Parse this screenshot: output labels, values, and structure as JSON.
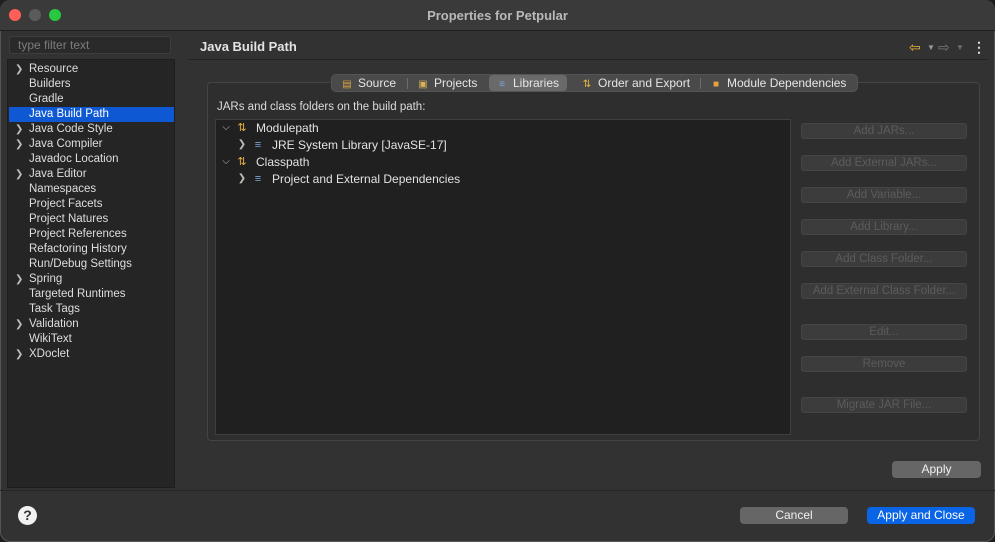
{
  "window": {
    "title": "Properties for Petpular"
  },
  "filter": {
    "placeholder": "type filter text"
  },
  "nav": {
    "items": [
      {
        "label": "Resource",
        "expandable": true
      },
      {
        "label": "Builders",
        "expandable": false
      },
      {
        "label": "Gradle",
        "expandable": false
      },
      {
        "label": "Java Build Path",
        "expandable": false,
        "selected": true
      },
      {
        "label": "Java Code Style",
        "expandable": true
      },
      {
        "label": "Java Compiler",
        "expandable": true
      },
      {
        "label": "Javadoc Location",
        "expandable": false
      },
      {
        "label": "Java Editor",
        "expandable": true
      },
      {
        "label": "Namespaces",
        "expandable": false
      },
      {
        "label": "Project Facets",
        "expandable": false
      },
      {
        "label": "Project Natures",
        "expandable": false
      },
      {
        "label": "Project References",
        "expandable": false
      },
      {
        "label": "Refactoring History",
        "expandable": false
      },
      {
        "label": "Run/Debug Settings",
        "expandable": false
      },
      {
        "label": "Spring",
        "expandable": true
      },
      {
        "label": "Targeted Runtimes",
        "expandable": false
      },
      {
        "label": "Task Tags",
        "expandable": false
      },
      {
        "label": "Validation",
        "expandable": true
      },
      {
        "label": "WikiText",
        "expandable": false
      },
      {
        "label": "XDoclet",
        "expandable": true
      }
    ]
  },
  "page": {
    "title": "Java Build Path"
  },
  "tabs": [
    {
      "label": "Source",
      "icon": "source-folder-icon"
    },
    {
      "label": "Projects",
      "icon": "folder-icon"
    },
    {
      "label": "Libraries",
      "icon": "library-icon",
      "active": true
    },
    {
      "label": "Order and Export",
      "icon": "order-arrows-icon"
    },
    {
      "label": "Module Dependencies",
      "icon": "module-icon"
    }
  ],
  "build_path": {
    "label": "JARs and class folders on the build path:",
    "tree": [
      {
        "label": "Modulepath",
        "expanded": true,
        "icon": "modulepath-icon"
      },
      {
        "label": "JRE System Library [JavaSE-17]",
        "expanded": false,
        "icon": "library-icon"
      },
      {
        "label": "Classpath",
        "expanded": true,
        "icon": "classpath-icon"
      },
      {
        "label": "Project and External Dependencies",
        "expanded": false,
        "icon": "library-icon"
      }
    ]
  },
  "side_buttons": [
    {
      "label": "Add JARs...",
      "enabled": false
    },
    {
      "label": "Add External JARs...",
      "enabled": false
    },
    {
      "label": "Add Variable...",
      "enabled": false
    },
    {
      "label": "Add Library...",
      "enabled": false
    },
    {
      "label": "Add Class Folder...",
      "enabled": false
    },
    {
      "label": "Add External Class Folder...",
      "enabled": false
    },
    {
      "label": "Edit...",
      "enabled": false
    },
    {
      "label": "Remove",
      "enabled": false
    },
    {
      "label": "Migrate JAR File...",
      "enabled": false
    }
  ],
  "footer": {
    "apply_label": "Apply",
    "cancel_label": "Cancel",
    "apply_close_label": "Apply and Close",
    "help_symbol": "?"
  },
  "colors": {
    "accent": "#0a64e6",
    "selection": "#0e59d3",
    "window_bg": "#323232"
  }
}
